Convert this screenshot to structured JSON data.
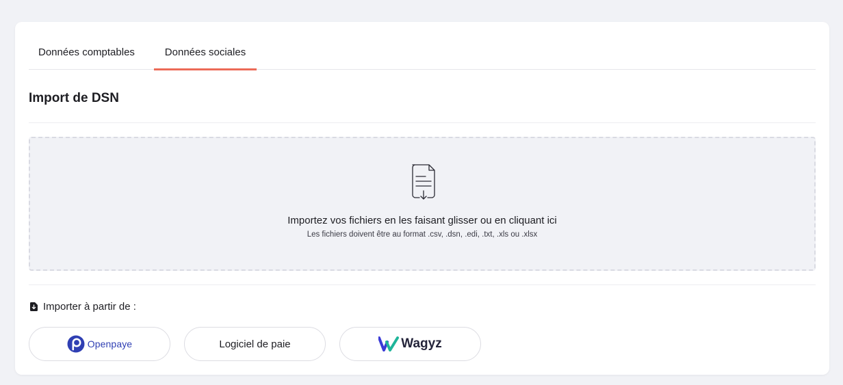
{
  "tabs": [
    {
      "label": "Données comptables",
      "active": false
    },
    {
      "label": "Données sociales",
      "active": true
    }
  ],
  "section": {
    "title": "Import de DSN"
  },
  "dropzone": {
    "icon": "file-download-icon",
    "main_text": "Importez vos fichiers en les faisant glisser ou en cliquant ici",
    "sub_text": "Les fichiers doivent être au format .csv, .dsn, .edi, .txt, .xls ou .xlsx"
  },
  "import_from": {
    "icon": "file-import-icon",
    "label": "Importer à partir de :"
  },
  "providers": [
    {
      "name": "Openpaye",
      "icon": "openpaye-logo-icon"
    },
    {
      "name": "Logiciel de paie"
    },
    {
      "name": "Wagyz",
      "icon": "wagyz-logo-icon"
    }
  ],
  "colors": {
    "accent": "#ec6a57",
    "page_background": "#f1f2f6",
    "card_background": "#ffffff",
    "openpaye_blue": "#2f3fb3",
    "wagyz_blue": "#3b3bd6",
    "wagyz_green": "#1fb59a"
  }
}
